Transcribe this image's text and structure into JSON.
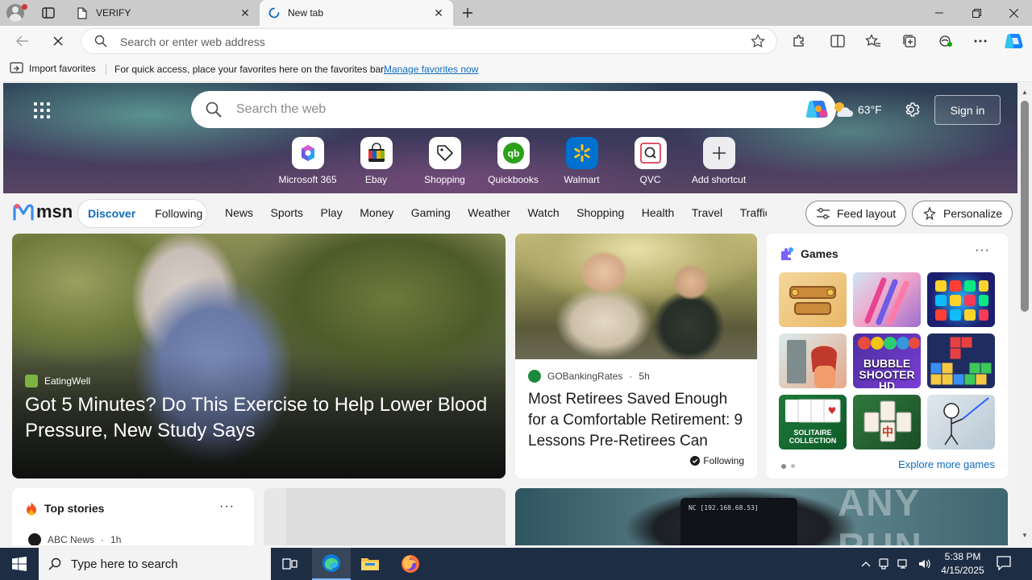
{
  "browser": {
    "tabs": [
      {
        "title": "VERIFY",
        "active": false
      },
      {
        "title": "New tab",
        "active": true
      }
    ],
    "address": {
      "placeholder": "Search or enter web address",
      "value": ""
    },
    "favorites_bar": {
      "import_label": "Import favorites",
      "message": "For quick access, place your favorites here on the favorites bar.",
      "manage_link": "Manage favorites now"
    }
  },
  "newtab": {
    "search_placeholder": "Search the web",
    "weather": {
      "temperature": "63",
      "unit": "°F"
    },
    "signin_label": "Sign in",
    "shortcuts": [
      {
        "label": "Microsoft 365",
        "icon": "microsoft365-icon"
      },
      {
        "label": "Ebay",
        "icon": "ebay-bag-icon"
      },
      {
        "label": "Shopping",
        "icon": "tag-icon"
      },
      {
        "label": "Quickbooks",
        "icon": "quickbooks-icon"
      },
      {
        "label": "Walmart",
        "icon": "walmart-spark-icon"
      },
      {
        "label": "QVC",
        "icon": "qvc-icon"
      },
      {
        "label": "Add shortcut",
        "icon": "plus-icon"
      }
    ]
  },
  "msn": {
    "logo": "msn",
    "pills": [
      "Discover",
      "Following"
    ],
    "active_pill": "Discover",
    "nav": [
      "News",
      "Sports",
      "Play",
      "Money",
      "Gaming",
      "Weather",
      "Watch",
      "Shopping",
      "Health",
      "Travel",
      "Traffic"
    ],
    "feed_layout_label": "Feed layout",
    "personalize_label": "Personalize",
    "hero": {
      "source": "EatingWell",
      "title": "Got 5 Minutes? Do This Exercise to Help Lower Blood Pressure, New Study Says"
    },
    "story": {
      "source": "GOBankingRates",
      "time": "5h",
      "title": "Most Retirees Saved Enough for a Comfortable Retirement: 9 Lessons Pre-Retirees Can Learn",
      "following_label": "Following"
    },
    "games": {
      "title": "Games",
      "tiles": [
        "",
        "",
        "",
        "",
        "BUBBLE SHOOTER HD",
        "",
        "SOLITAIRE COLLECTION",
        "",
        ""
      ],
      "explore_label": "Explore more games"
    },
    "top_stories": {
      "title": "Top stories",
      "source": "ABC News",
      "time": "1h"
    },
    "phone_text": "NC [192.168.68.53]",
    "watermark": "ANY RUN"
  },
  "taskbar": {
    "search_placeholder": "Type here to search",
    "time": "5:38 PM",
    "date": "4/15/2025"
  },
  "colors": {
    "accent": "#0f6cbd",
    "taskbar": "#1d2d44",
    "tab_strip": "#cbcbcb"
  }
}
